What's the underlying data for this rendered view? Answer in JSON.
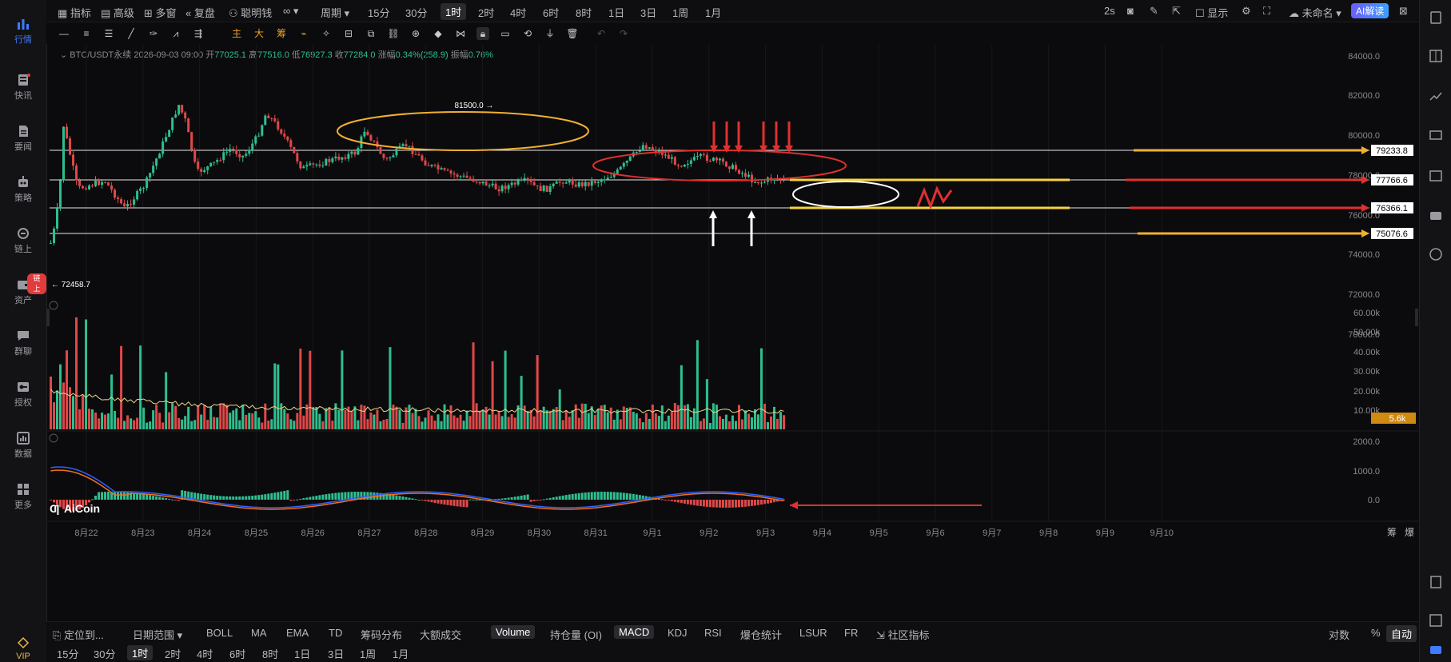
{
  "left_nav": [
    {
      "label": "行情",
      "icon": "bar-chart-icon",
      "active": true
    },
    {
      "label": "快讯",
      "icon": "news-icon"
    },
    {
      "label": "要闻",
      "icon": "document-icon"
    },
    {
      "label": "策略",
      "icon": "robot-icon"
    },
    {
      "label": "链上",
      "icon": "chain-icon"
    },
    {
      "label": "资产",
      "icon": "wallet-icon",
      "badge": "链上"
    },
    {
      "label": "群聊",
      "icon": "chat-icon"
    },
    {
      "label": "授权",
      "icon": "key-icon"
    },
    {
      "label": "数据",
      "icon": "data-icon"
    },
    {
      "label": "更多",
      "icon": "grid-icon"
    },
    {
      "label": "VIP",
      "icon": "diamond-icon"
    }
  ],
  "top_toolbar": {
    "items": [
      "指标",
      "高级",
      "多窗",
      "复盘",
      "聪明钱",
      "∞",
      "周期"
    ],
    "intervals": [
      "15分",
      "30分",
      "1时",
      "2时",
      "4时",
      "6时",
      "8时",
      "1日",
      "3日",
      "1周",
      "1月"
    ],
    "selected_interval": "1时",
    "right": {
      "refresh": "2s",
      "display": "显示",
      "account": "未命名",
      "ai": "AI解读"
    }
  },
  "draw_toolbar": {
    "labels": [
      "主",
      "大",
      "筹"
    ]
  },
  "info_line": {
    "symbol": "BTC/USDT永续",
    "time": "2026-09-03 09:00",
    "open_label": "开",
    "open": "77025.1",
    "high_label": "高",
    "high": "77516.0",
    "low_label": "低",
    "low": "76927.3",
    "close_label": "收",
    "close": "77284.0",
    "change_label": "涨幅",
    "change": "0.34%(258.9)",
    "amp_label": "振幅",
    "amp": "0.76%"
  },
  "price_axis": [
    "84000.0",
    "82000.0",
    "80000.0",
    "78000.0",
    "76000.0",
    "74000.0",
    "72000.0",
    "70000.0"
  ],
  "price_tags": [
    "79233.8",
    "77766.6",
    "76366.1",
    "75076.6"
  ],
  "annotations": {
    "high": "81500.0",
    "low": "72458.7"
  },
  "volume_axis": [
    "60.00k",
    "50.00k",
    "40.00k",
    "30.00k",
    "20.00k",
    "10.00k"
  ],
  "volume_tag": "5.6k",
  "macd_axis": [
    "2000.0",
    "1000.0",
    "0.0"
  ],
  "watermark": "AiCoin",
  "dates": [
    "8月22",
    "8月23",
    "8月24",
    "8月25",
    "8月26",
    "8月27",
    "8月28",
    "8月29",
    "8月30",
    "8月31",
    "9月1",
    "9月2",
    "9月3",
    "9月4",
    "9月5",
    "9月6",
    "9月7",
    "9月8",
    "9月9",
    "9月10"
  ],
  "date_axis_right": [
    "筹",
    "爆"
  ],
  "indicator_bar": {
    "locate": "定位到...",
    "range": "日期范围",
    "items": [
      "BOLL",
      "MA",
      "EMA",
      "TD",
      "筹码分布",
      "大额成交"
    ],
    "sub_items": [
      "Volume",
      "持仓量 (OI)",
      "MACD",
      "KDJ",
      "RSI",
      "爆仓统计",
      "LSUR",
      "FR",
      "社区指标"
    ],
    "selected": [
      "Volume",
      "MACD"
    ],
    "right": [
      "对数",
      "%",
      "自动"
    ]
  },
  "timeframe_bar": {
    "items": [
      "15分",
      "30分",
      "1时",
      "2时",
      "4时",
      "6时",
      "8时",
      "1日",
      "3日",
      "1周",
      "1月"
    ],
    "selected": "1时"
  },
  "colors": {
    "up": "#2fbf8f",
    "down": "#e04848",
    "accent": "#3d7bff",
    "yellow": "#f5d33c",
    "orange": "#f0a020"
  }
}
